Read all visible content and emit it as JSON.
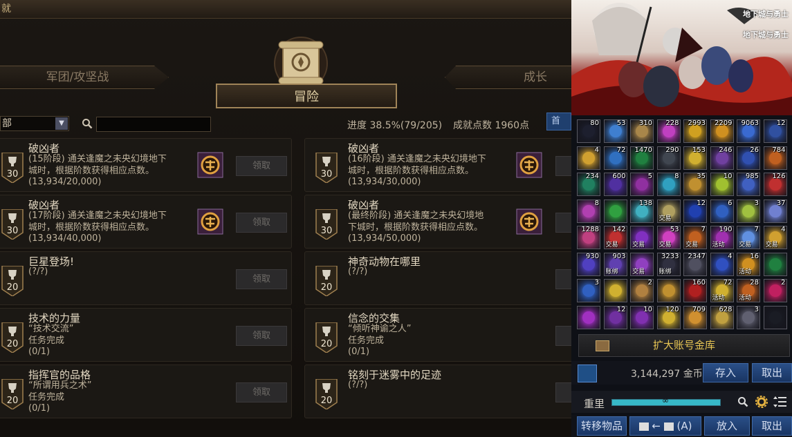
{
  "window": {
    "title_fragment": "就"
  },
  "tabs": {
    "left": "军团/攻坚战",
    "center": "冒险",
    "right": "成长"
  },
  "filter": {
    "selected": "部",
    "search_placeholder": ""
  },
  "stats": {
    "progress": "进度  38.5%(79/205)",
    "points": "成就点数 1960点"
  },
  "blue_button_label": "首",
  "claim_label": "领取",
  "cards": [
    {
      "points": "30",
      "title": "破凶者",
      "desc": "(15阶段) 通关逢魔之未央幻境地下\n城时，根据阶数获得相应点数。",
      "progress": "(13,934/20,000)",
      "reward": true
    },
    {
      "points": "30",
      "title": "破凶者",
      "desc": "(16阶段) 通关逢魔之未央幻境地下\n城时，根据阶数获得相应点数。",
      "progress": "(13,934/30,000)",
      "reward": true
    },
    {
      "points": "30",
      "title": "破凶者",
      "desc": "(17阶段) 通关逢魔之未央幻境地下\n城时，根据阶数获得相应点数。",
      "progress": "(13,934/40,000)",
      "reward": true
    },
    {
      "points": "30",
      "title": "破凶者",
      "desc": "(最终阶段) 通关逢魔之未央幻境地\n下城时，根据阶数获得相应点数。",
      "progress": "(13,934/50,000)",
      "reward": true
    },
    {
      "points": "20",
      "title": "巨星登场!",
      "desc": "",
      "progress": "(?/?)",
      "reward": false
    },
    {
      "points": "20",
      "title": "神奇动物在哪里",
      "desc": "",
      "progress": "(?/?)",
      "reward": false
    },
    {
      "points": "20",
      "title": "技术的力量",
      "desc": "“技术交流”\n任务完成",
      "progress": "(0/1)",
      "reward": false
    },
    {
      "points": "20",
      "title": "信念的交集",
      "desc": "“倾听神谕之人”\n任务完成",
      "progress": "(0/1)",
      "reward": false
    },
    {
      "points": "20",
      "title": "指挥官的品格",
      "desc": "“所谓用兵之术”\n任务完成",
      "progress": "(0/1)",
      "reward": false
    },
    {
      "points": "20",
      "title": "铭刻于迷雾中的足迹",
      "desc": "",
      "progress": "(?/?)",
      "reward": false
    }
  ],
  "banner": {
    "logo1": "地下城与勇士",
    "logo2": "地下城与勇士"
  },
  "inventory": [
    {
      "n": "80",
      "t": "",
      "c": "#1d1f2e"
    },
    {
      "n": "53",
      "t": "",
      "c": "#3f7fd0"
    },
    {
      "n": "310",
      "t": "",
      "c": "#a8864a"
    },
    {
      "n": "228",
      "t": "",
      "c": "#c040c0"
    },
    {
      "n": "2993",
      "t": "",
      "c": "#d0a020"
    },
    {
      "n": "2209",
      "t": "",
      "c": "#d09020"
    },
    {
      "n": "9063",
      "t": "",
      "c": "#3a6ad0"
    },
    {
      "n": "12",
      "t": "",
      "c": "#3050a0"
    },
    {
      "n": "4",
      "t": "",
      "c": "#d0a030"
    },
    {
      "n": "72",
      "t": "",
      "c": "#3070c0"
    },
    {
      "n": "1470",
      "t": "",
      "c": "#208040"
    },
    {
      "n": "290",
      "t": "",
      "c": "#404650"
    },
    {
      "n": "153",
      "t": "",
      "c": "#d0b030"
    },
    {
      "n": "246",
      "t": "",
      "c": "#7040a0"
    },
    {
      "n": "26",
      "t": "",
      "c": "#3050b0"
    },
    {
      "n": "784",
      "t": "",
      "c": "#c06020"
    },
    {
      "n": "234",
      "t": "",
      "c": "#208060"
    },
    {
      "n": "600",
      "t": "",
      "c": "#5030a0"
    },
    {
      "n": "5",
      "t": "",
      "c": "#9030a0"
    },
    {
      "n": "8",
      "t": "",
      "c": "#30a0c0"
    },
    {
      "n": "35",
      "t": "",
      "c": "#c09030"
    },
    {
      "n": "10",
      "t": "",
      "c": "#a0c030"
    },
    {
      "n": "985",
      "t": "",
      "c": "#4060c0"
    },
    {
      "n": "126",
      "t": "",
      "c": "#c03030"
    },
    {
      "n": "8",
      "t": "",
      "c": "#b040b0"
    },
    {
      "n": "",
      "t": "",
      "c": "#30a040"
    },
    {
      "n": "138",
      "t": "",
      "c": "#40b0c0"
    },
    {
      "n": "",
      "t": "交易",
      "c": "#b0a060"
    },
    {
      "n": "12",
      "t": "",
      "c": "#2040b0"
    },
    {
      "n": "6",
      "t": "",
      "c": "#3060c0"
    },
    {
      "n": "3",
      "t": "",
      "c": "#a0c040"
    },
    {
      "n": "37",
      "t": "",
      "c": "#7080d0"
    },
    {
      "n": "1288",
      "t": "",
      "c": "#c04080"
    },
    {
      "n": "142",
      "t": "交易",
      "c": "#c03030"
    },
    {
      "n": "",
      "t": "交易",
      "c": "#8030c0"
    },
    {
      "n": "53",
      "t": "交易",
      "c": "#d040c0"
    },
    {
      "n": "7",
      "t": "交易",
      "c": "#c06020"
    },
    {
      "n": "190",
      "t": "活动",
      "c": "#a030b0"
    },
    {
      "n": "7",
      "t": "交易",
      "c": "#6090e0"
    },
    {
      "n": "4",
      "t": "交易",
      "c": "#d0a030"
    },
    {
      "n": "930",
      "t": "",
      "c": "#5040c0"
    },
    {
      "n": "903",
      "t": "账绑",
      "c": "#6040b0"
    },
    {
      "n": "",
      "t": "交易",
      "c": "#9040c0"
    },
    {
      "n": "3233",
      "t": "账绑",
      "c": "#303040"
    },
    {
      "n": "2347",
      "t": "",
      "c": "#505060"
    },
    {
      "n": "4",
      "t": "",
      "c": "#3050c0"
    },
    {
      "n": "16",
      "t": "活动",
      "c": "#d09020"
    },
    {
      "n": "",
      "t": "",
      "c": "#208040"
    },
    {
      "n": "3",
      "t": "",
      "c": "#3060c0"
    },
    {
      "n": "",
      "t": "",
      "c": "#d0b030"
    },
    {
      "n": "2",
      "t": "",
      "c": "#b08040"
    },
    {
      "n": "",
      "t": "",
      "c": "#c09030"
    },
    {
      "n": "160",
      "t": "",
      "c": "#b02020"
    },
    {
      "n": "72",
      "t": "活动",
      "c": "#d0b030"
    },
    {
      "n": "28",
      "t": "活动",
      "c": "#c06020"
    },
    {
      "n": "2",
      "t": "",
      "c": "#c02060"
    },
    {
      "n": "",
      "t": "",
      "c": "#a030c0"
    },
    {
      "n": "12",
      "t": "",
      "c": "#7030a0"
    },
    {
      "n": "10",
      "t": "",
      "c": "#8030b0"
    },
    {
      "n": "120",
      "t": "",
      "c": "#d0b030"
    },
    {
      "n": "709",
      "t": "",
      "c": "#d09030"
    },
    {
      "n": "628",
      "t": "",
      "c": "#c0a040"
    },
    {
      "n": "3",
      "t": "",
      "c": "#606070"
    },
    {
      "n": "",
      "t": "",
      "c": "#1a1c24"
    }
  ],
  "expand_label": "扩大账号金库",
  "gold": {
    "amount": "3,144,297 金币",
    "deposit": "存入",
    "withdraw": "取出"
  },
  "character": {
    "name": "重里",
    "symbol": "∞"
  },
  "transfer": {
    "label": "转移物品",
    "slot_text": "(A)",
    "put": "放入",
    "take": "取出"
  }
}
